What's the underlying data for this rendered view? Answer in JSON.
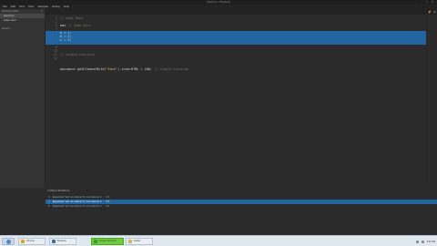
{
  "window": {
    "title": "sketch.js - Brackets",
    "controls": [
      "–",
      "□",
      "✕"
    ]
  },
  "menu": [
    "File",
    "Edit",
    "Find",
    "View",
    "Navigate",
    "Debug",
    "Help"
  ],
  "sidebar": {
    "header": "Working Files",
    "close": "×",
    "files": [
      "sketch.js",
      "index.html"
    ],
    "folder_label": "sketch"
  },
  "gutter": [
    "1",
    "2",
    "3",
    "4",
    "5",
    "6",
    "7",
    "8",
    "9",
    "10",
    "11",
    "12"
  ],
  "code": {
    "line1": "// Some Vars",
    "line3_kw": "var",
    "line3_rest": " // Some Vars",
    "line4": "a = 1;",
    "line5": "b = 2;",
    "line6": "c = 3;",
    "line8": "// Simple Function",
    "line10_code": "document.getElementById(",
    "line10_str": "\"test\"",
    "line10_code2": ").innerHTML = 100;",
    "line10_comment": " // Simple Function"
  },
  "problems": {
    "header": "4 JSLint Problems",
    "rows": [
      {
        "num": "3",
        "text": "Expected 'var' at column 5, not column 1.",
        "loc": "4:1"
      },
      {
        "num": "4",
        "text": "Expected 'var' at column 5, not column 1.",
        "loc": "5:1"
      },
      {
        "num": "5",
        "text": "Expected 'var' at column 5, not column 1.",
        "loc": "6:1"
      }
    ]
  },
  "taskbar": {
    "buttons": [
      {
        "label": "Chrome",
        "color": "#e0a020"
      },
      {
        "label": "Brackets",
        "color": "#2a6fb0"
      },
      {
        "label": "Screen Recorder",
        "color": "#3a9a2a"
      },
      {
        "label": "Folder",
        "color": "#d8b050"
      }
    ],
    "clock": "3:21 PM"
  },
  "colors": {
    "selection": "#2265a0",
    "editor_bg": "#2b2b2b",
    "active_task": "#6ecb3c"
  }
}
